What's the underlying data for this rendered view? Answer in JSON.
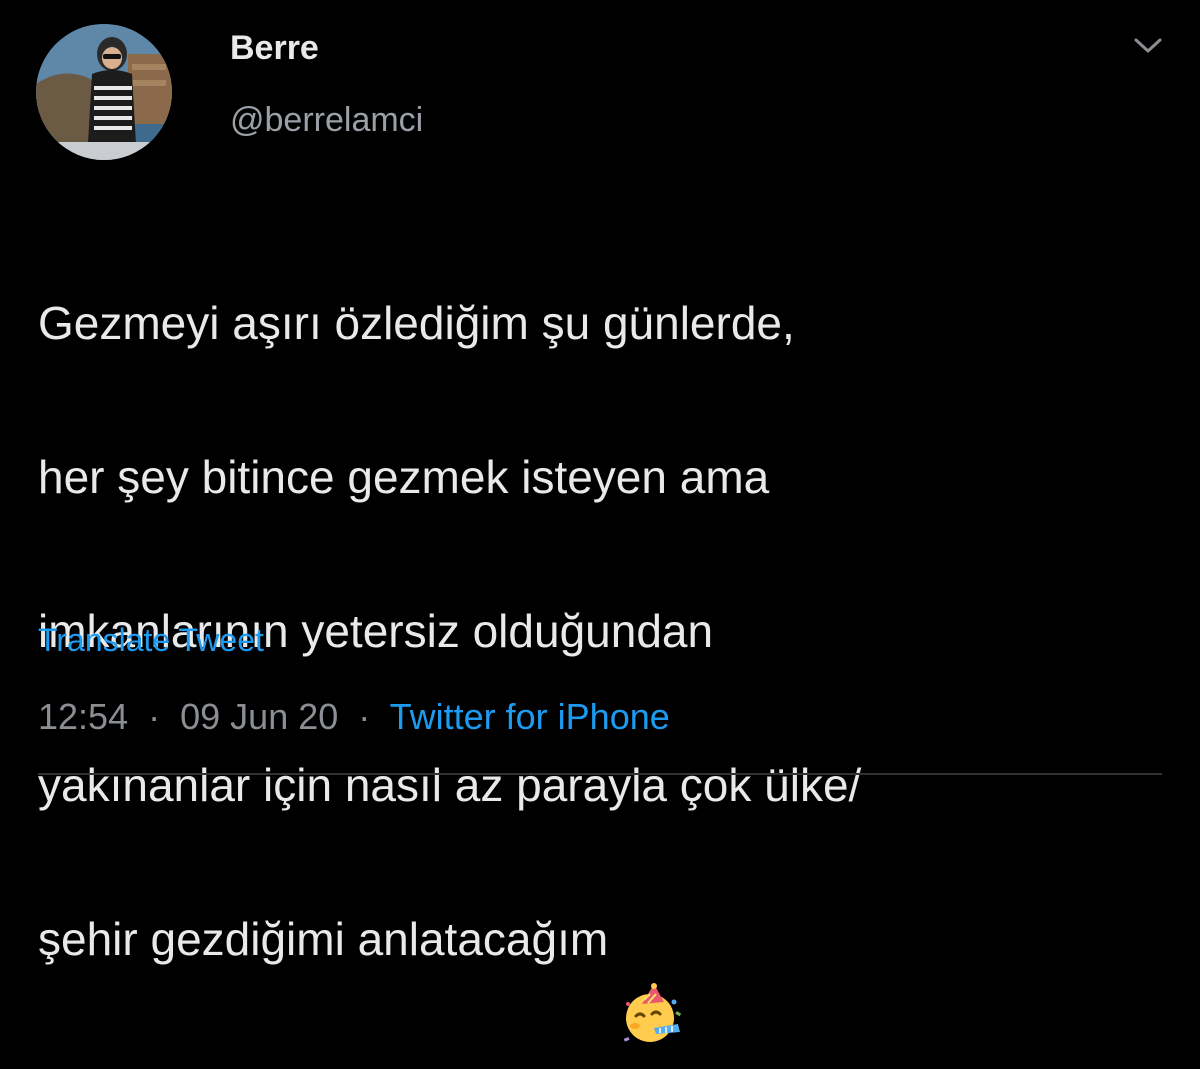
{
  "tweet": {
    "author": {
      "name": "Berre",
      "handle": "@berrelamci"
    },
    "text_lines": [
      "Gezmeyi aşırı özlediğim şu günlerde,",
      "her şey bitince gezmek isteyen ama",
      "imkanlarının yetersiz olduğundan",
      "yakınanlar için nasıl az parayla çok ülke/",
      "şehir gezdiğimi anlatacağım"
    ],
    "emoji": "partying-face-emoji",
    "translate_label": "Translate Tweet",
    "time": "12:54",
    "separator": "·",
    "date": "09 Jun 20",
    "source": "Twitter for iPhone"
  },
  "icons": {
    "menu": "chevron-down-icon"
  },
  "colors": {
    "background": "#000000",
    "text": "#e7e9ea",
    "secondary": "#8b8f94",
    "link": "#1d9bf0",
    "divider": "#2f3336"
  }
}
